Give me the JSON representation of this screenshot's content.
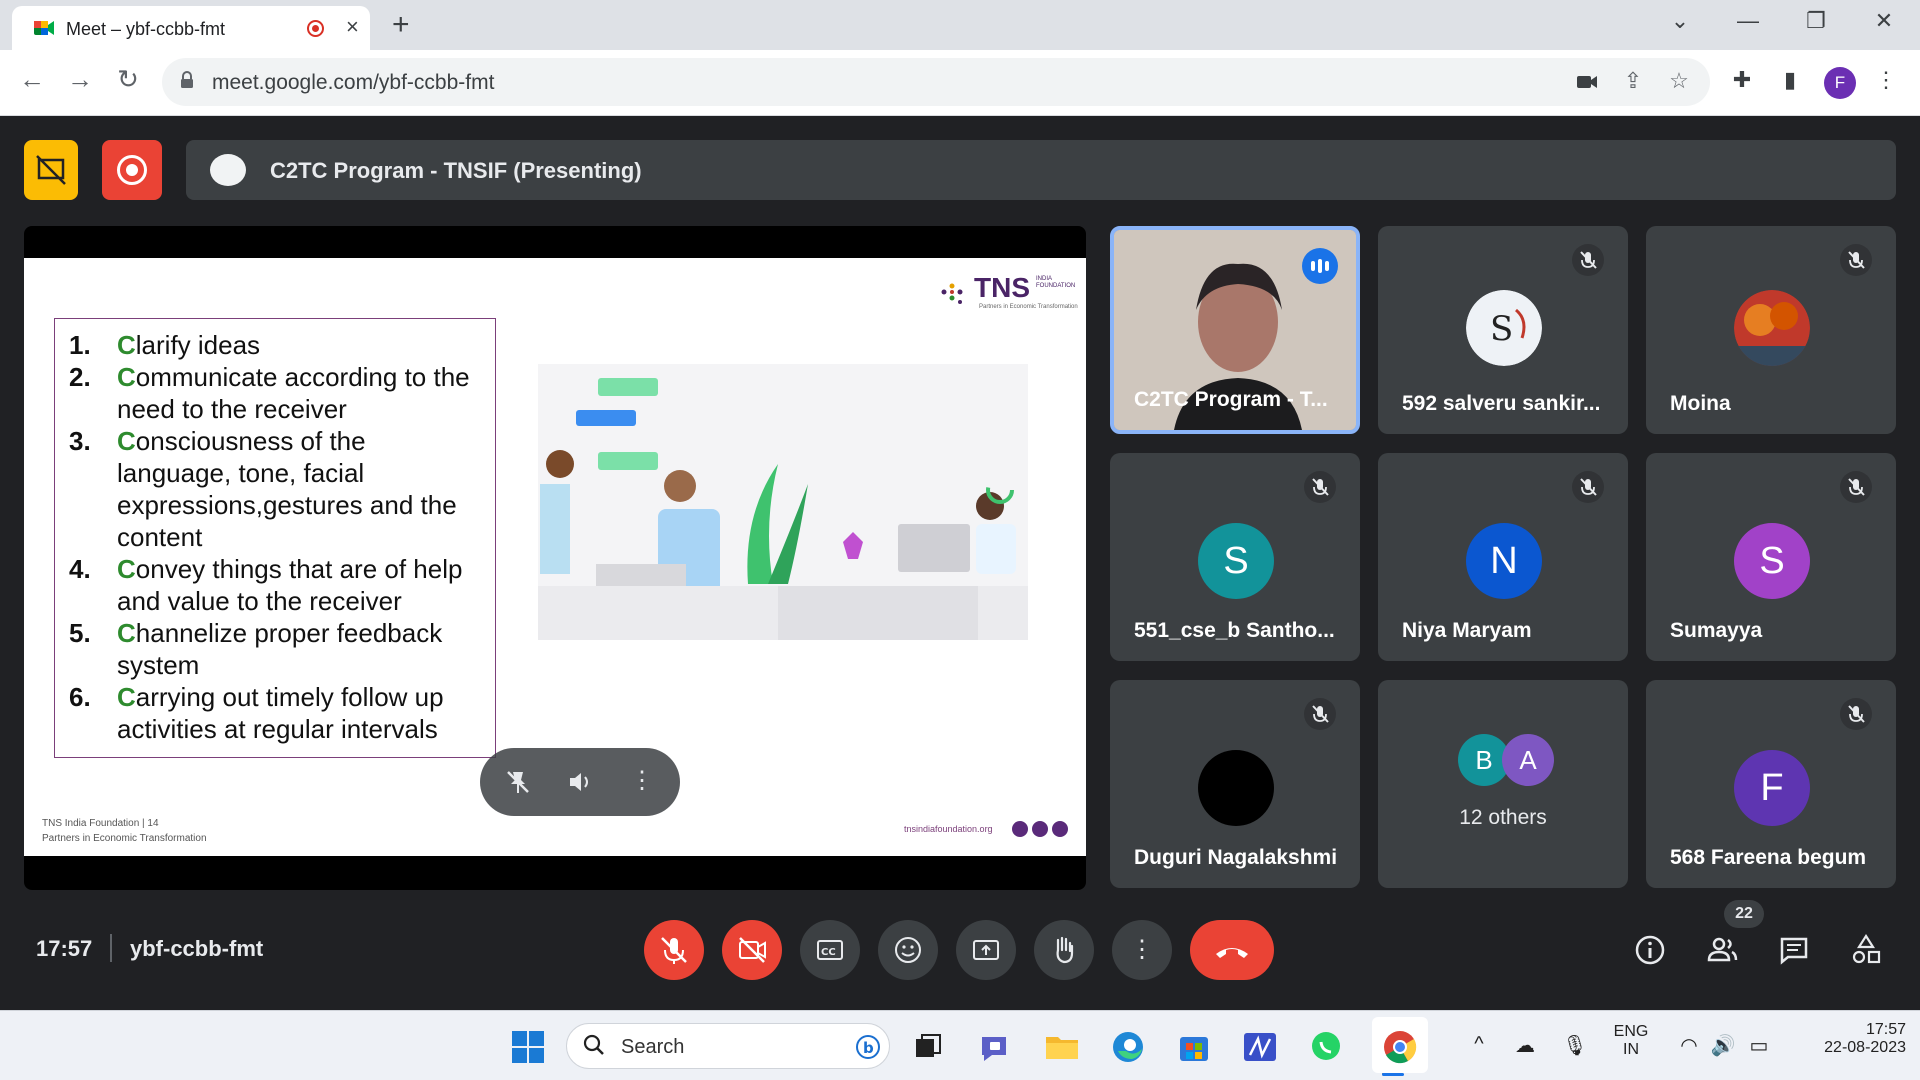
{
  "browser": {
    "tab_title": "Meet – ybf-ccbb-fmt",
    "close_tab": "×",
    "new_tab": "+",
    "url": "meet.google.com/ybf-ccbb-fmt",
    "profile_initial": "F"
  },
  "meet": {
    "presenting_title": "C2TC Program - TNSIF (Presenting)",
    "time": "17:57",
    "meeting_code": "ybf-ccbb-fmt",
    "people_count": "22",
    "accent_color": "#8ab4f8",
    "end_call_color": "#ea4335"
  },
  "slide": {
    "logo_text": "TNS",
    "logo_small": "INDIA FOUNDATION",
    "logo_tagline": "Partners in Economic Transformation",
    "items": [
      {
        "num": "1.",
        "first": "C",
        "rest": "larify ideas"
      },
      {
        "num": "2.",
        "first": "C",
        "rest": "ommunicate according to the need to the receiver"
      },
      {
        "num": "3.",
        "first": "C",
        "rest": "onsciousness of the language, tone, facial expressions,gestures and the content"
      },
      {
        "num": "4.",
        "first": "C",
        "rest": "onvey things that are of help and value to the receiver"
      },
      {
        "num": "5.",
        "first": "C",
        "rest": "hannelize proper feedback system"
      },
      {
        "num": "6.",
        "first": "C",
        "rest": "arrying out timely follow up activities at regular intervals"
      }
    ],
    "footer_line1": "TNS India Foundation | 14",
    "footer_line2": "Partners in Economic Transformation",
    "website": "tnsindiafoundation.org"
  },
  "tiles": [
    {
      "name": "C2TC Program - T...",
      "type": "video"
    },
    {
      "name": "592 salveru sankir...",
      "type": "image"
    },
    {
      "name": "Moina",
      "type": "image"
    },
    {
      "name": "551_cse_b Santho...",
      "initial": "S",
      "color": "#12939a"
    },
    {
      "name": "Niya Maryam",
      "initial": "N",
      "color": "#0b57d0"
    },
    {
      "name": "Sumayya",
      "initial": "S",
      "color": "#a142c8"
    },
    {
      "name": "Duguri Nagalakshmi",
      "initial": "",
      "color": "#000000"
    },
    {
      "name": "12 others",
      "initials": [
        "B",
        "A"
      ],
      "colors": [
        "#12939a",
        "#7e57c2"
      ]
    },
    {
      "name": "568 Fareena begum",
      "initial": "F",
      "color": "#5e35b1"
    }
  ],
  "taskbar": {
    "search_label": "Search",
    "lang_line1": "ENG",
    "lang_line2": "IN",
    "clock_time": "17:57",
    "clock_date": "22-08-2023"
  }
}
